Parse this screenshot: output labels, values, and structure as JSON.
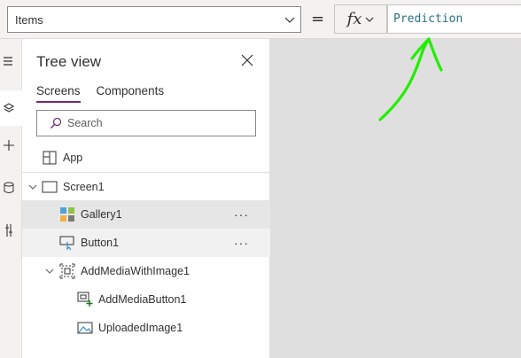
{
  "formula_bar": {
    "property": "Items",
    "equals": "=",
    "fx_label": "fx",
    "formula": "Prediction"
  },
  "tree_view": {
    "title": "Tree view",
    "tabs": [
      {
        "label": "Screens",
        "active": true
      },
      {
        "label": "Components",
        "active": false
      }
    ],
    "search_placeholder": "Search",
    "nodes": [
      {
        "label": "App",
        "icon": "app-icon"
      },
      {
        "label": "Screen1",
        "icon": "screen-icon",
        "expanded": true
      },
      {
        "label": "Gallery1",
        "icon": "gallery-icon",
        "selected": true,
        "more": "···"
      },
      {
        "label": "Button1",
        "icon": "button-icon",
        "more": "···"
      },
      {
        "label": "AddMediaWithImage1",
        "icon": "group-icon",
        "expanded": true
      },
      {
        "label": "AddMediaButton1",
        "icon": "add-media-icon"
      },
      {
        "label": "UploadedImage1",
        "icon": "image-icon"
      }
    ]
  },
  "colors": {
    "accent": "#742774",
    "formula_text": "#2a6f8a",
    "annotation": "#22ee00"
  }
}
